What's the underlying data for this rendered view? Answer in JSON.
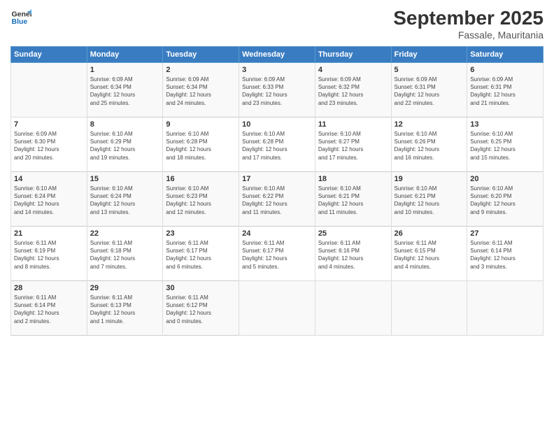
{
  "logo": {
    "line1": "General",
    "line2": "Blue"
  },
  "title": "September 2025",
  "subtitle": "Fassale, Mauritania",
  "days_header": [
    "Sunday",
    "Monday",
    "Tuesday",
    "Wednesday",
    "Thursday",
    "Friday",
    "Saturday"
  ],
  "weeks": [
    [
      {
        "num": "",
        "info": ""
      },
      {
        "num": "1",
        "info": "Sunrise: 6:09 AM\nSunset: 6:34 PM\nDaylight: 12 hours\nand 25 minutes."
      },
      {
        "num": "2",
        "info": "Sunrise: 6:09 AM\nSunset: 6:34 PM\nDaylight: 12 hours\nand 24 minutes."
      },
      {
        "num": "3",
        "info": "Sunrise: 6:09 AM\nSunset: 6:33 PM\nDaylight: 12 hours\nand 23 minutes."
      },
      {
        "num": "4",
        "info": "Sunrise: 6:09 AM\nSunset: 6:32 PM\nDaylight: 12 hours\nand 23 minutes."
      },
      {
        "num": "5",
        "info": "Sunrise: 6:09 AM\nSunset: 6:31 PM\nDaylight: 12 hours\nand 22 minutes."
      },
      {
        "num": "6",
        "info": "Sunrise: 6:09 AM\nSunset: 6:31 PM\nDaylight: 12 hours\nand 21 minutes."
      }
    ],
    [
      {
        "num": "7",
        "info": "Sunrise: 6:09 AM\nSunset: 6:30 PM\nDaylight: 12 hours\nand 20 minutes."
      },
      {
        "num": "8",
        "info": "Sunrise: 6:10 AM\nSunset: 6:29 PM\nDaylight: 12 hours\nand 19 minutes."
      },
      {
        "num": "9",
        "info": "Sunrise: 6:10 AM\nSunset: 6:28 PM\nDaylight: 12 hours\nand 18 minutes."
      },
      {
        "num": "10",
        "info": "Sunrise: 6:10 AM\nSunset: 6:28 PM\nDaylight: 12 hours\nand 17 minutes."
      },
      {
        "num": "11",
        "info": "Sunrise: 6:10 AM\nSunset: 6:27 PM\nDaylight: 12 hours\nand 17 minutes."
      },
      {
        "num": "12",
        "info": "Sunrise: 6:10 AM\nSunset: 6:26 PM\nDaylight: 12 hours\nand 16 minutes."
      },
      {
        "num": "13",
        "info": "Sunrise: 6:10 AM\nSunset: 6:25 PM\nDaylight: 12 hours\nand 15 minutes."
      }
    ],
    [
      {
        "num": "14",
        "info": "Sunrise: 6:10 AM\nSunset: 6:24 PM\nDaylight: 12 hours\nand 14 minutes."
      },
      {
        "num": "15",
        "info": "Sunrise: 6:10 AM\nSunset: 6:24 PM\nDaylight: 12 hours\nand 13 minutes."
      },
      {
        "num": "16",
        "info": "Sunrise: 6:10 AM\nSunset: 6:23 PM\nDaylight: 12 hours\nand 12 minutes."
      },
      {
        "num": "17",
        "info": "Sunrise: 6:10 AM\nSunset: 6:22 PM\nDaylight: 12 hours\nand 11 minutes."
      },
      {
        "num": "18",
        "info": "Sunrise: 6:10 AM\nSunset: 6:21 PM\nDaylight: 12 hours\nand 11 minutes."
      },
      {
        "num": "19",
        "info": "Sunrise: 6:10 AM\nSunset: 6:21 PM\nDaylight: 12 hours\nand 10 minutes."
      },
      {
        "num": "20",
        "info": "Sunrise: 6:10 AM\nSunset: 6:20 PM\nDaylight: 12 hours\nand 9 minutes."
      }
    ],
    [
      {
        "num": "21",
        "info": "Sunrise: 6:11 AM\nSunset: 6:19 PM\nDaylight: 12 hours\nand 8 minutes."
      },
      {
        "num": "22",
        "info": "Sunrise: 6:11 AM\nSunset: 6:18 PM\nDaylight: 12 hours\nand 7 minutes."
      },
      {
        "num": "23",
        "info": "Sunrise: 6:11 AM\nSunset: 6:17 PM\nDaylight: 12 hours\nand 6 minutes."
      },
      {
        "num": "24",
        "info": "Sunrise: 6:11 AM\nSunset: 6:17 PM\nDaylight: 12 hours\nand 5 minutes."
      },
      {
        "num": "25",
        "info": "Sunrise: 6:11 AM\nSunset: 6:16 PM\nDaylight: 12 hours\nand 4 minutes."
      },
      {
        "num": "26",
        "info": "Sunrise: 6:11 AM\nSunset: 6:15 PM\nDaylight: 12 hours\nand 4 minutes."
      },
      {
        "num": "27",
        "info": "Sunrise: 6:11 AM\nSunset: 6:14 PM\nDaylight: 12 hours\nand 3 minutes."
      }
    ],
    [
      {
        "num": "28",
        "info": "Sunrise: 6:11 AM\nSunset: 6:14 PM\nDaylight: 12 hours\nand 2 minutes."
      },
      {
        "num": "29",
        "info": "Sunrise: 6:11 AM\nSunset: 6:13 PM\nDaylight: 12 hours\nand 1 minute."
      },
      {
        "num": "30",
        "info": "Sunrise: 6:11 AM\nSunset: 6:12 PM\nDaylight: 12 hours\nand 0 minutes."
      },
      {
        "num": "",
        "info": ""
      },
      {
        "num": "",
        "info": ""
      },
      {
        "num": "",
        "info": ""
      },
      {
        "num": "",
        "info": ""
      }
    ]
  ]
}
